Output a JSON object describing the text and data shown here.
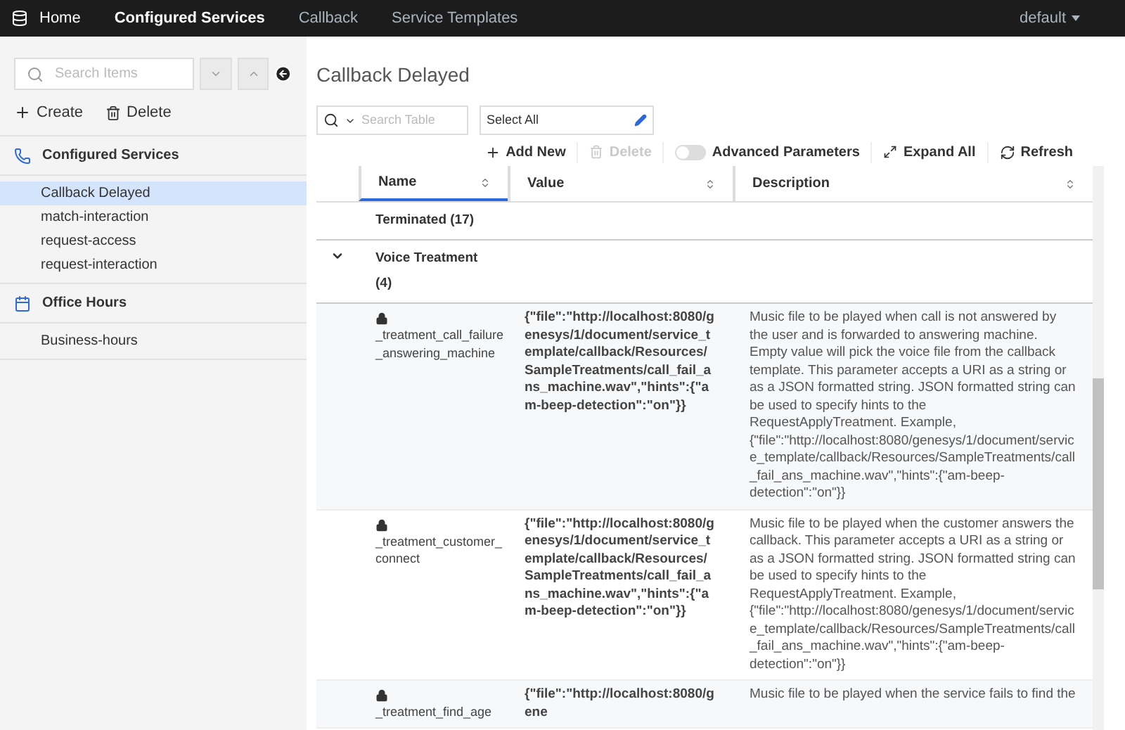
{
  "nav": {
    "items": [
      {
        "label": "Home",
        "selected": false,
        "kind": "home"
      },
      {
        "label": "Configured Services",
        "selected": true,
        "kind": "link"
      },
      {
        "label": "Callback",
        "selected": false,
        "kind": "link"
      },
      {
        "label": "Service Templates",
        "selected": false,
        "kind": "link"
      }
    ],
    "user": "default"
  },
  "sidebar": {
    "search": {
      "placeholder": "Search Items"
    },
    "actions": [
      "Create",
      "Delete"
    ],
    "sections": [
      {
        "title": "Configured Services",
        "kind": "phone",
        "items": [
          {
            "label": "Callback Delayed",
            "selected": true
          },
          {
            "label": "match-interaction",
            "selected": false
          },
          {
            "label": "request-access",
            "selected": false
          },
          {
            "label": "request-interaction",
            "selected": false
          }
        ]
      },
      {
        "title": "Office Hours",
        "kind": "calendar",
        "items": [
          {
            "label": "Business-hours",
            "selected": false
          }
        ]
      }
    ]
  },
  "main": {
    "title": "Callback Delayed",
    "search": {
      "placeholder": "Search Table"
    },
    "select": {
      "value": "Select All"
    },
    "toolbar": {
      "add": "Add New",
      "delete": "Delete",
      "delete_disabled": true,
      "advanced": {
        "label": "Advanced Parameters",
        "on": false
      },
      "expand": "Expand All",
      "refresh": "Refresh"
    },
    "table": {
      "columns": [
        "Name",
        "Value",
        "Description"
      ],
      "groups": [
        {
          "label": "Terminated (17)",
          "expanded": false
        },
        {
          "label": "Voice Treatment (4)",
          "expanded": true,
          "rows": [
            {
              "name": "_treatment_call_failure_answering_machine",
              "value": "{\"file\":\"http://localhost:8080/genesys/1/document/service_template/callback/Resources/SampleTreatments/call_fail_ans_machine.wav\",\"hints\":{\"am-beep-detection\":\"on\"}}",
              "description": "Music file to be played when call is not answered by the user and is forwarded to answering machine. Empty value will pick the voice file from the callback template. This parameter accepts a URI as a string or as a JSON formatted string. JSON formatted string can be used to specify hints to the RequestApplyTreatment. Example, {\"file\":\"http://localhost:8080/genesys/1/document/service_template/callback/Resources/SampleTreatments/call_fail_ans_machine.wav\",\"hints\":{\"am-beep-detection\":\"on\"}}"
            },
            {
              "name": "_treatment_customer_connect",
              "value": "{\"file\":\"http://localhost:8080/genesys/1/document/service_template/callback/Resources/SampleTreatments/call_fail_ans_machine.wav\",\"hints\":{\"am-beep-detection\":\"on\"}}",
              "description": "Music file to be played when the customer answers the callback. This parameter accepts a URI as a string or as a JSON formatted string. JSON formatted string can be used to specify hints to the RequestApplyTreatment. Example, {\"file\":\"http://localhost:8080/genesys/1/document/service_template/callback/Resources/SampleTreatments/call_fail_ans_machine.wav\",\"hints\":{\"am-beep-detection\":\"on\"}}"
            },
            {
              "name": "_treatment_find_age",
              "value": "{\"file\":\"http://localhost:8080/gene",
              "description": "Music file to be played when the service fails to find the"
            }
          ]
        }
      ]
    }
  }
}
